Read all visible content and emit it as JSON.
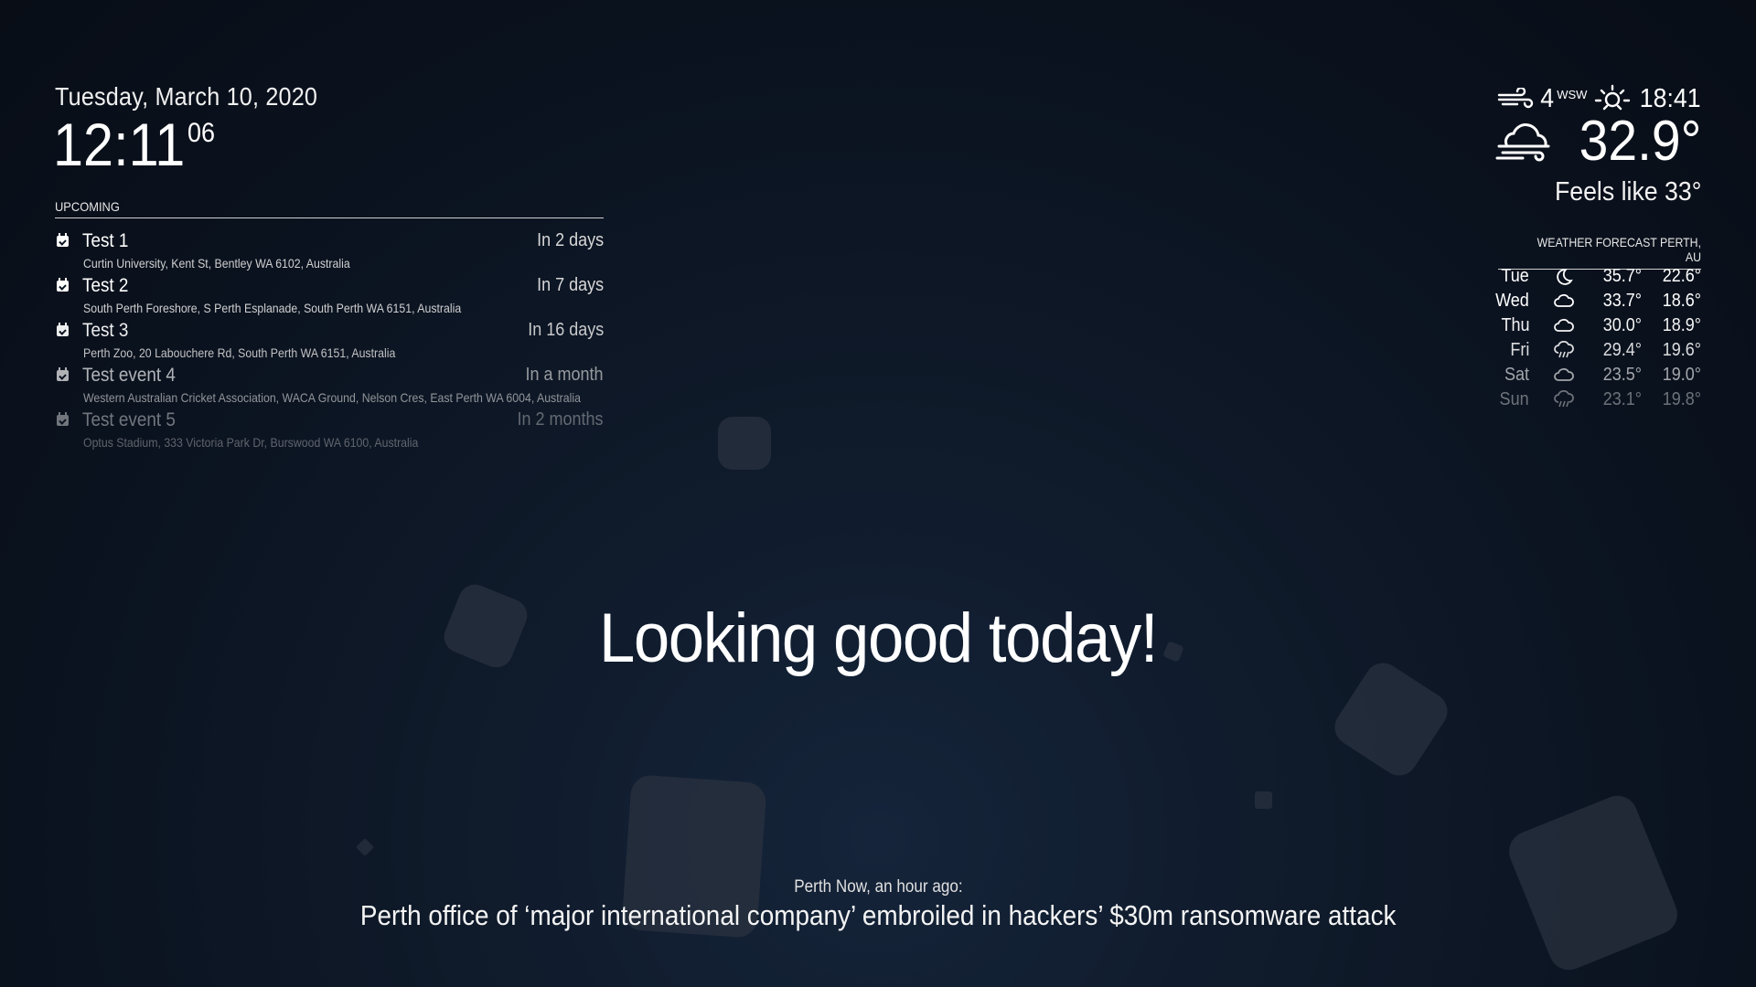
{
  "clock": {
    "date": "Tuesday, March 10, 2020",
    "time": "12:11",
    "seconds": "06"
  },
  "calendar": {
    "header": "UPCOMING",
    "icon": "calendar-check-icon",
    "events": [
      {
        "title": "Test 1",
        "when": "In 2 days",
        "location": "Curtin University, Kent St, Bentley WA 6102, Australia"
      },
      {
        "title": "Test 2",
        "when": "In 7 days",
        "location": "South Perth Foreshore, S Perth Esplanade, South Perth WA 6151, Australia"
      },
      {
        "title": "Test 3",
        "when": "In 16 days",
        "location": "Perth Zoo, 20 Labouchere Rd, South Perth WA 6151, Australia"
      },
      {
        "title": "Test event 4",
        "when": "In a month",
        "location": "Western Australian Cricket Association, WACA Ground, Nelson Cres, East Perth WA 6004, Australia"
      },
      {
        "title": "Test event 5",
        "when": "In 2 months",
        "location": "Optus Stadium, 333 Victoria Park Dr, Burswood WA 6100, Australia"
      }
    ]
  },
  "current_weather": {
    "wind_speed": "4",
    "wind_direction": "WSW",
    "sunset_time": "18:41",
    "temperature": "32.9°",
    "feels_like": "Feels like 33°",
    "wind_icon": "wind-icon",
    "sunset_icon": "sunset-icon",
    "condition_icon": "cloudy-windy-icon"
  },
  "forecast": {
    "header": "WEATHER FORECAST PERTH, AU",
    "days": [
      {
        "day": "Tue",
        "icon": "clear-night-icon",
        "max": "35.7°",
        "min": "22.6°"
      },
      {
        "day": "Wed",
        "icon": "cloud-icon",
        "max": "33.7°",
        "min": "18.6°"
      },
      {
        "day": "Thu",
        "icon": "cloud-icon",
        "max": "30.0°",
        "min": "18.9°"
      },
      {
        "day": "Fri",
        "icon": "rain-icon",
        "max": "29.4°",
        "min": "19.6°"
      },
      {
        "day": "Sat",
        "icon": "cloud-icon",
        "max": "23.5°",
        "min": "19.0°"
      },
      {
        "day": "Sun",
        "icon": "rain-icon",
        "max": "23.1°",
        "min": "19.8°"
      }
    ]
  },
  "compliment": "Looking good today!",
  "news": {
    "source": "Perth Now, an hour ago:",
    "headline": "Perth office of ‘major international company’ embroiled in hackers’ $30m ransomware attack"
  },
  "colors": {
    "background": "#0b1320",
    "text": "#ffffff",
    "shape": "#2a3240"
  }
}
